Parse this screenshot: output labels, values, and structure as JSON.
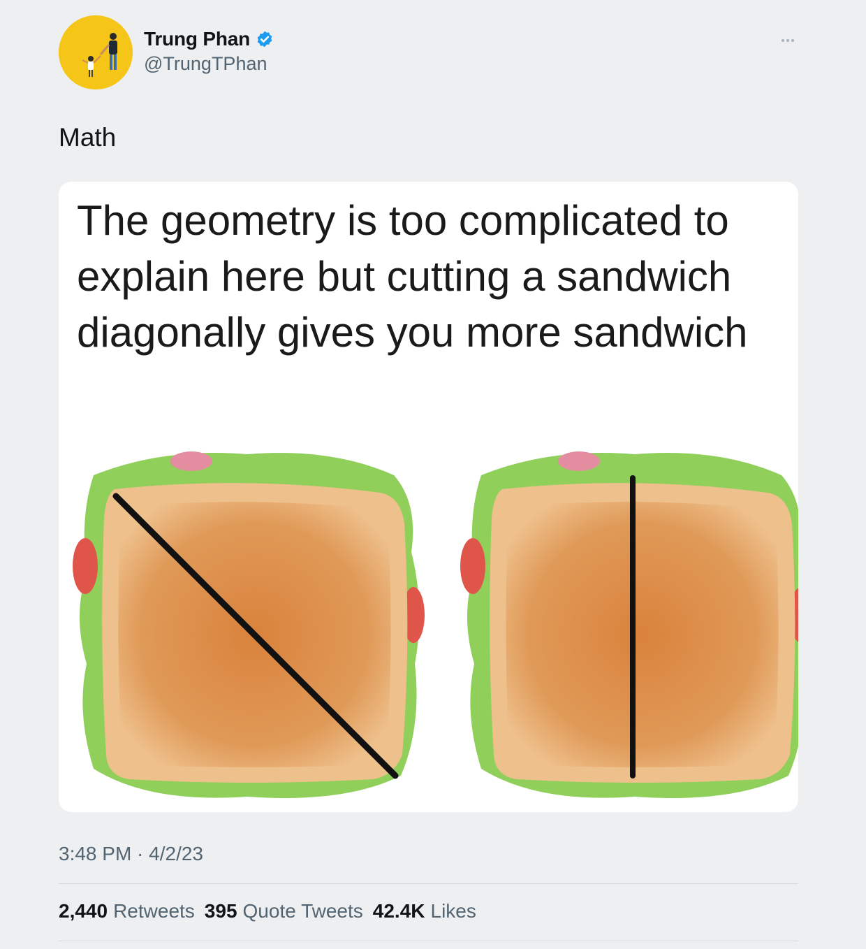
{
  "author": {
    "display_name": "Trung Phan",
    "handle": "@TrungTPhan",
    "verified": true
  },
  "tweet": {
    "text": "Math",
    "image_caption": "The geometry is too complicated to explain here but cutting a sandwich diagonally gives you more sandwich",
    "timestamp": "3:48 PM · 4/2/23"
  },
  "stats": [
    {
      "value": "2,440",
      "label": "Retweets"
    },
    {
      "value": "395",
      "label": "Quote Tweets"
    },
    {
      "value": "42.4K",
      "label": "Likes"
    }
  ],
  "icons": {
    "verified": "verified-badge-icon",
    "more": "more-dots-icon"
  },
  "colors": {
    "background": "#eeeff1",
    "verified_blue": "#1d9bf0",
    "secondary_text": "#536471",
    "avatar_bg": "#f5c518"
  }
}
